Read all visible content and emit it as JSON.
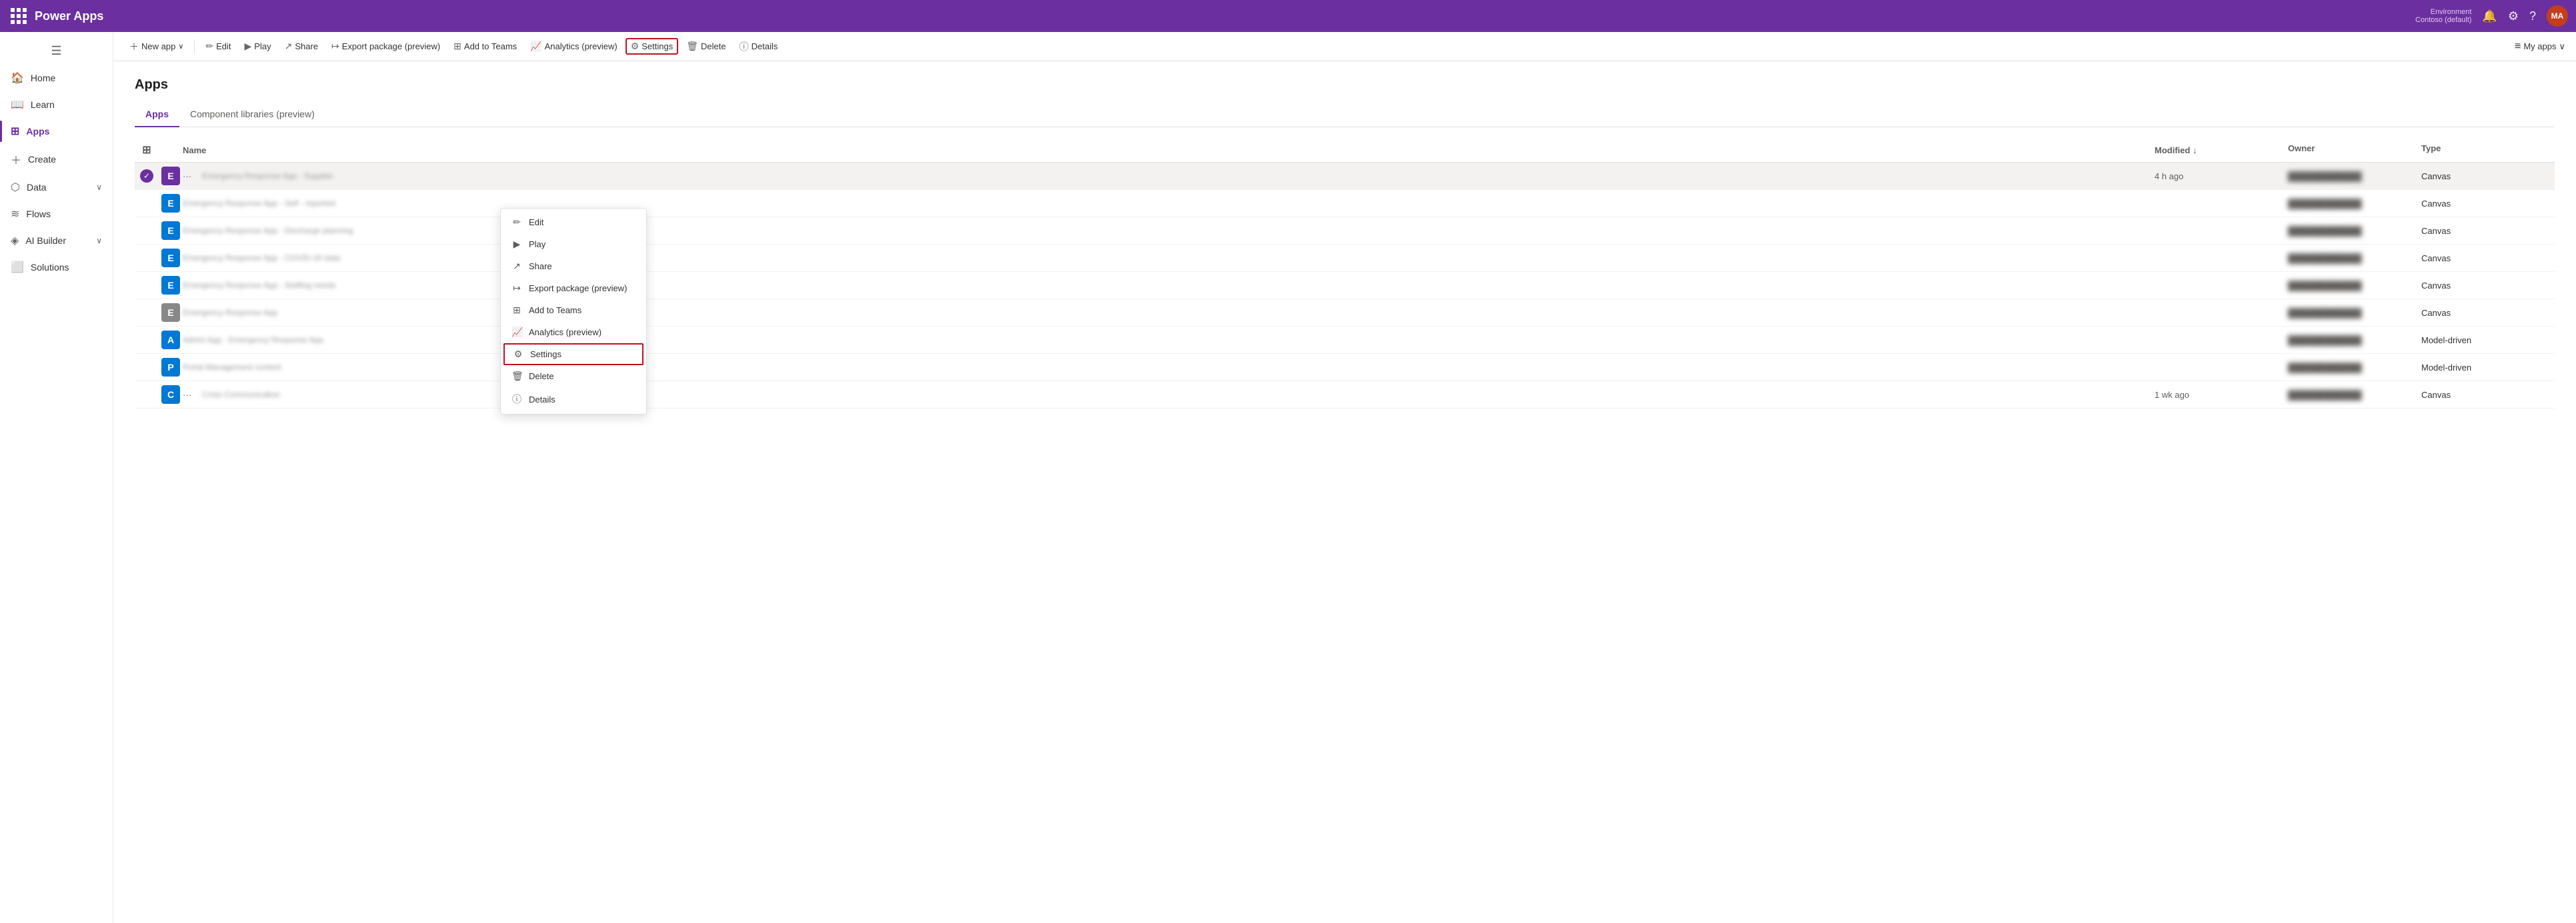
{
  "topbar": {
    "app_name": "Power Apps",
    "environment_label": "Environment",
    "environment_name": "Contoso (default)"
  },
  "toolbar": {
    "new_app": "New app",
    "edit": "Edit",
    "play": "Play",
    "share": "Share",
    "export_package": "Export package (preview)",
    "add_to_teams": "Add to Teams",
    "analytics": "Analytics (preview)",
    "settings": "Settings",
    "delete": "Delete",
    "details": "Details",
    "my_apps": "My apps"
  },
  "sidebar": {
    "toggle_icon": "☰",
    "items": [
      {
        "label": "Home",
        "icon": "🏠",
        "active": false
      },
      {
        "label": "Learn",
        "icon": "📖",
        "active": false
      },
      {
        "label": "Apps",
        "icon": "⊞",
        "active": true
      },
      {
        "label": "Create",
        "icon": "+",
        "active": false
      },
      {
        "label": "Data",
        "icon": "⬡",
        "active": false,
        "expandable": true
      },
      {
        "label": "Flows",
        "icon": "≋",
        "active": false
      },
      {
        "label": "AI Builder",
        "icon": "◈",
        "active": false,
        "expandable": true
      },
      {
        "label": "Solutions",
        "icon": "⬜",
        "active": false
      }
    ]
  },
  "main": {
    "page_title": "Apps",
    "tabs": [
      {
        "label": "Apps",
        "active": true
      },
      {
        "label": "Component libraries (preview)",
        "active": false
      }
    ],
    "table": {
      "columns": [
        "",
        "",
        "Name",
        "Modified",
        "Owner",
        "Type"
      ],
      "rows": [
        {
          "selected": true,
          "icon_color": "#6b2fa0",
          "icon_letter": "E",
          "name": "Emergency Response App - Supplier",
          "name_blurred": true,
          "modified": "4 h ago",
          "owner": "████████████",
          "type": "Canvas"
        },
        {
          "selected": false,
          "icon_color": "#0078d4",
          "icon_letter": "E",
          "name": "Emergency Response App - Self - reported",
          "name_blurred": true,
          "modified": "",
          "owner": "████████████",
          "type": "Canvas"
        },
        {
          "selected": false,
          "icon_color": "#0078d4",
          "icon_letter": "E",
          "name": "Emergency Response App - Discharge planning",
          "name_blurred": true,
          "modified": "",
          "owner": "████████████",
          "type": "Canvas"
        },
        {
          "selected": false,
          "icon_color": "#0078d4",
          "icon_letter": "E",
          "name": "Emergency Response App - COVID-19 stats",
          "name_blurred": true,
          "modified": "",
          "owner": "████████████",
          "type": "Canvas"
        },
        {
          "selected": false,
          "icon_color": "#0078d4",
          "icon_letter": "E",
          "name": "Emergency Response App - Staffing needs",
          "name_blurred": true,
          "modified": "",
          "owner": "████████████",
          "type": "Canvas"
        },
        {
          "selected": false,
          "icon_color": "#888",
          "icon_letter": "E",
          "name": "Emergency Response App",
          "name_blurred": true,
          "modified": "",
          "owner": "████████████",
          "type": "Canvas"
        },
        {
          "selected": false,
          "icon_color": "#0078d4",
          "icon_letter": "A",
          "name": "Admin App - Emergency Response App",
          "name_blurred": true,
          "modified": "",
          "owner": "████████████",
          "type": "Model-driven"
        },
        {
          "selected": false,
          "icon_color": "#0078d4",
          "icon_letter": "P",
          "name": "Portal Management content",
          "name_blurred": true,
          "modified": "",
          "owner": "████████████",
          "type": "Model-driven"
        },
        {
          "selected": false,
          "icon_color": "#0078d4",
          "icon_letter": "C",
          "name": "Crisis Communication",
          "name_blurred": true,
          "modified": "1 wk ago",
          "owner": "████████████",
          "type": "Canvas"
        }
      ]
    },
    "context_menu": {
      "visible": true,
      "items": [
        {
          "label": "Edit",
          "icon": "✏️"
        },
        {
          "label": "Play",
          "icon": "▶"
        },
        {
          "label": "Share",
          "icon": "↗"
        },
        {
          "label": "Export package (preview)",
          "icon": "↦"
        },
        {
          "label": "Add to Teams",
          "icon": "⊞"
        },
        {
          "label": "Analytics (preview)",
          "icon": "📈"
        },
        {
          "label": "Settings",
          "icon": "⚙",
          "highlighted": true
        },
        {
          "label": "Delete",
          "icon": "🗑"
        },
        {
          "label": "Details",
          "icon": "ⓘ"
        }
      ]
    }
  },
  "avatar": {
    "initials": "MA",
    "bg": "#c43e1c"
  }
}
